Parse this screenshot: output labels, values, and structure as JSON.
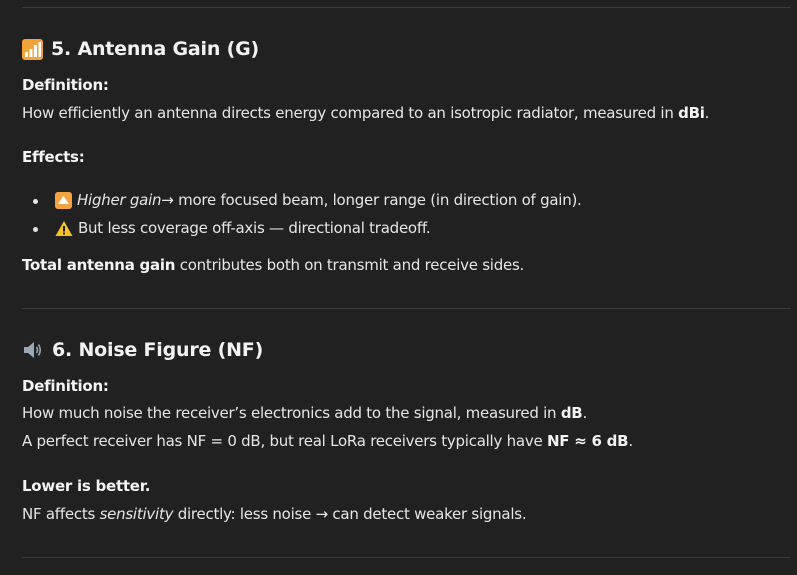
{
  "section5": {
    "heading": "5. Antenna Gain (G)",
    "definition_label": "Definition:",
    "definition_text_pre": "How efficiently an antenna directs energy compared to an isotropic radiator, measured in ",
    "definition_unit": "dBi",
    "definition_text_post": ".",
    "effects_label": "Effects:",
    "bullet1_em": "Higher gain",
    "bullet1_rest": " → more focused beam, longer range (in direction of gain).",
    "bullet2_text": "But less coverage off-axis — directional tradeoff.",
    "summary_strong": "Total antenna gain",
    "summary_rest": " contributes both on transmit and receive sides."
  },
  "section6": {
    "heading": "6. Noise Figure (NF)",
    "definition_label": "Definition:",
    "line1_pre": "How much noise the receiver’s electronics add to the signal, measured in ",
    "line1_unit": "dB",
    "line1_post": ".",
    "line2_pre": "A perfect receiver has NF = 0 dB, but real LoRa receivers typically have ",
    "line2_strong": "NF ≈ 6 dB",
    "line2_post": ".",
    "lower_label": "Lower is better.",
    "line3_pre": "NF affects ",
    "line3_em": "sensitivity",
    "line3_post": " directly: less noise → can detect weaker signals."
  },
  "icons": {
    "section5_icon": "antenna-bars-icon",
    "section6_icon": "speaker-icon",
    "bullet1_icon": "up-arrow-button-icon",
    "bullet2_icon": "warning-icon"
  },
  "colors": {
    "background": "#212121",
    "text": "#e6e6e6",
    "divider": "#3c3c3c",
    "icon_orange": "#f2a33a",
    "warning_yellow": "#f7c325"
  }
}
